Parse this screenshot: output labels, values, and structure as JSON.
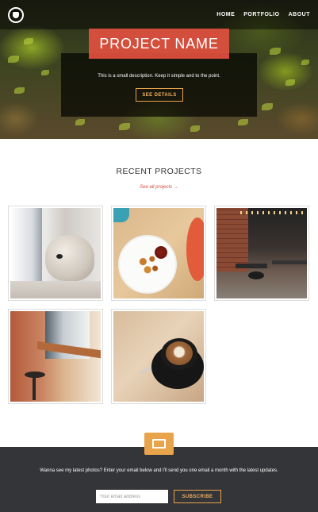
{
  "nav": {
    "items": [
      "HOME",
      "PORTFOLIO",
      "ABOUT"
    ]
  },
  "hero": {
    "title": "PROJECT NAME",
    "description": "This is a small description. Keep it simple and to the point.",
    "button_label": "SEE DETAILS"
  },
  "recent": {
    "title": "RECENT PROJECTS",
    "see_all": "See all projects →",
    "thumbnails": [
      "dog-photo",
      "food-plate-photo",
      "restaurant-interior-photo",
      "bar-stool-photo",
      "coffee-cup-photo"
    ]
  },
  "newsletter": {
    "text": "Wanna see my latest photos? Enter your email below and I'll send you one email a month with the latest updates.",
    "email_placeholder": "Your email address",
    "subscribe_label": "SUBSCRIBE"
  },
  "colors": {
    "accent": "#e8a44a",
    "title_bg": "#e0503e",
    "footer_bg": "#343538",
    "link": "#d04c3a"
  }
}
